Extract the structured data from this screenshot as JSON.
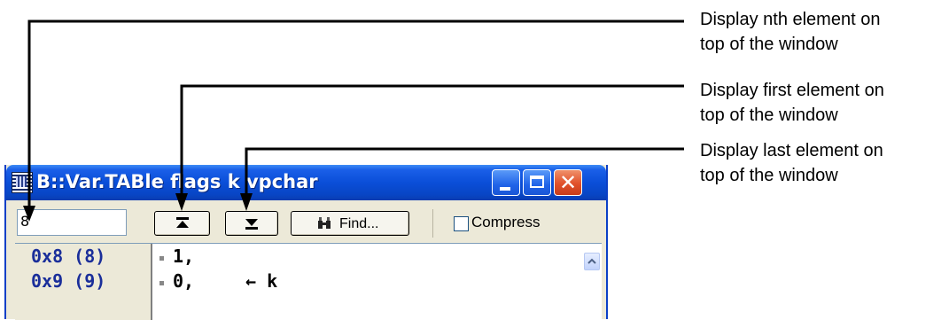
{
  "window": {
    "title": "B::Var.TABle flags k vpchar",
    "controls": {
      "minimize": "minimize-icon",
      "maximize": "maximize-icon",
      "close": "close-icon"
    }
  },
  "toolbar": {
    "index_value": "8",
    "first_button_icon": "go-first-icon",
    "last_button_icon": "go-last-icon",
    "find_label": "Find...",
    "compress_label": "Compress",
    "compress_checked": false
  },
  "rows": [
    {
      "addr": "0x8 (8)",
      "value": "1,",
      "note": ""
    },
    {
      "addr": "0x9 (9)",
      "value": "0,",
      "note": "← k"
    }
  ],
  "callouts": [
    {
      "line1": "Display nth element on",
      "line2": "top of the window"
    },
    {
      "line1": "Display first element on",
      "line2": "top of the window"
    },
    {
      "line1": "Display last element on",
      "line2": "top of the window"
    }
  ]
}
